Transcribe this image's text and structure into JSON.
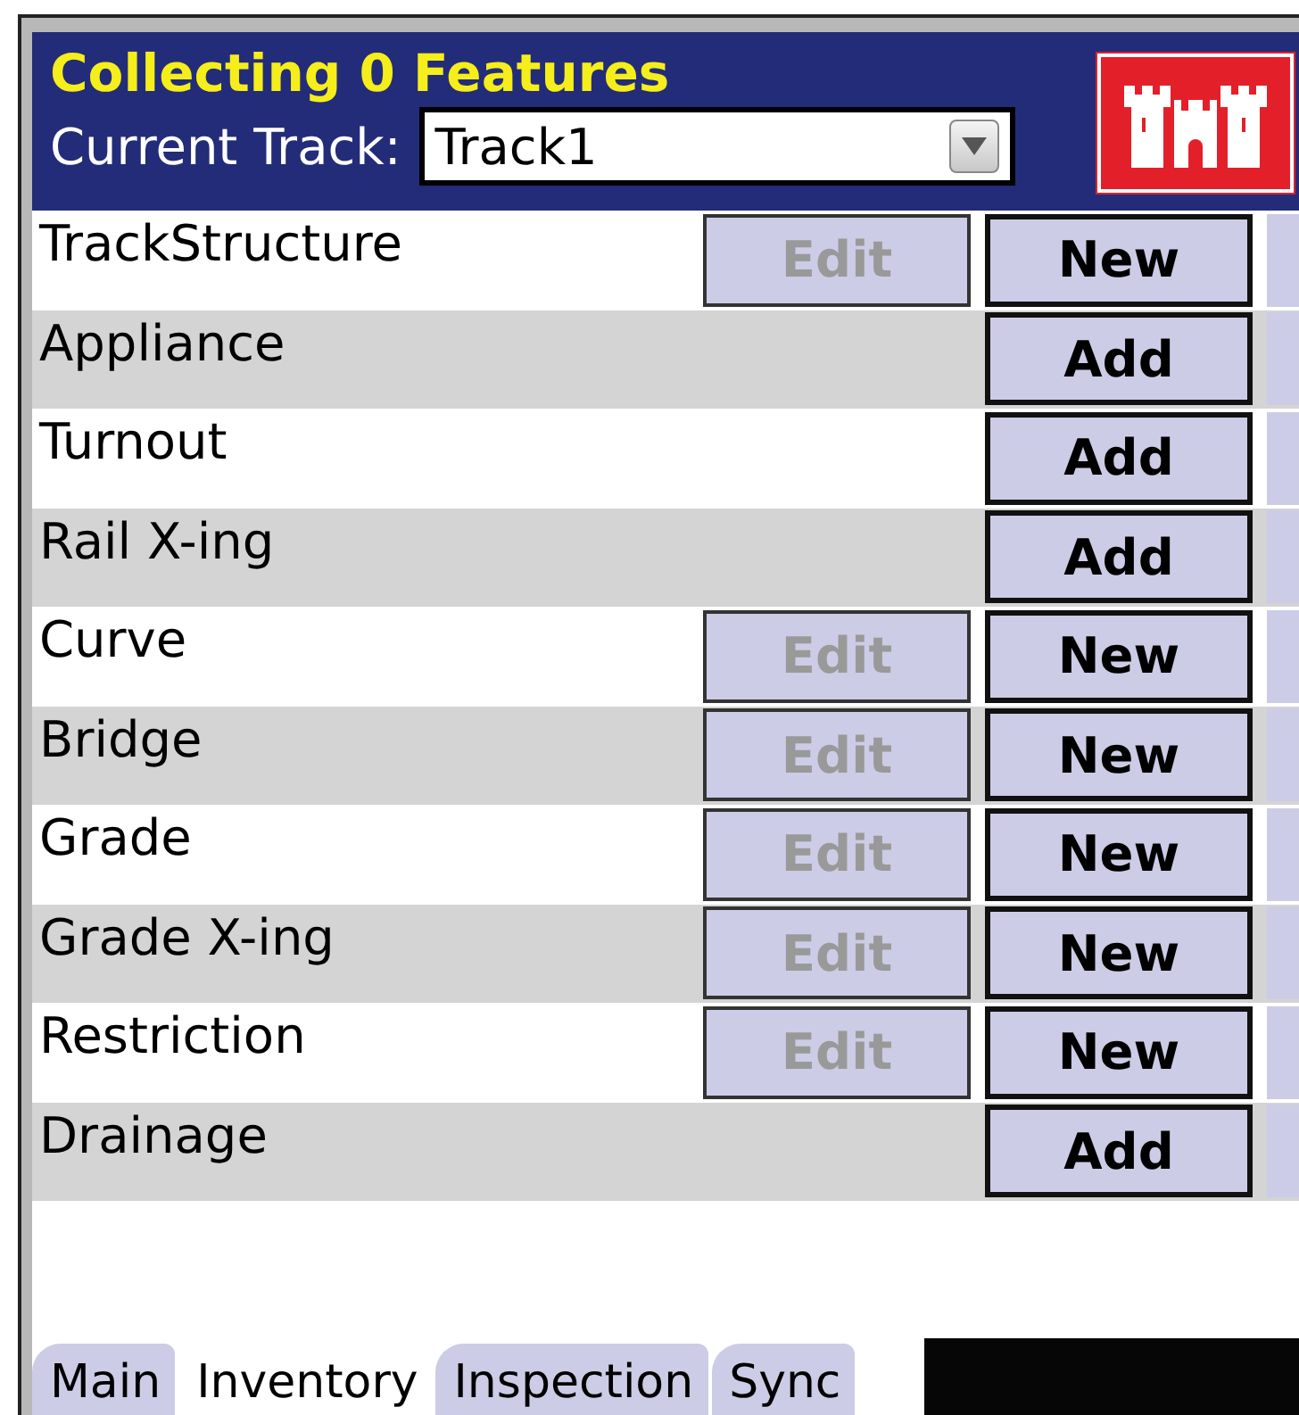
{
  "header": {
    "title": "Collecting 0 Features",
    "track_label": "Current Track:",
    "track_value": "Track1"
  },
  "rows": [
    {
      "label": "TrackStructure",
      "buttons": [
        {
          "label": "Edit",
          "disabled": true
        },
        {
          "label": "New",
          "disabled": false
        }
      ]
    },
    {
      "label": "Appliance",
      "buttons": [
        {
          "label": "Add",
          "disabled": false
        }
      ]
    },
    {
      "label": "Turnout",
      "buttons": [
        {
          "label": "Add",
          "disabled": false
        }
      ]
    },
    {
      "label": "Rail X-ing",
      "buttons": [
        {
          "label": "Add",
          "disabled": false
        }
      ]
    },
    {
      "label": "Curve",
      "buttons": [
        {
          "label": "Edit",
          "disabled": true
        },
        {
          "label": "New",
          "disabled": false
        }
      ]
    },
    {
      "label": "Bridge",
      "buttons": [
        {
          "label": "Edit",
          "disabled": true
        },
        {
          "label": "New",
          "disabled": false
        }
      ]
    },
    {
      "label": "Grade",
      "buttons": [
        {
          "label": "Edit",
          "disabled": true
        },
        {
          "label": "New",
          "disabled": false
        }
      ]
    },
    {
      "label": "Grade X-ing",
      "buttons": [
        {
          "label": "Edit",
          "disabled": true
        },
        {
          "label": "New",
          "disabled": false
        }
      ]
    },
    {
      "label": "Restriction",
      "buttons": [
        {
          "label": "Edit",
          "disabled": true
        },
        {
          "label": "New",
          "disabled": false
        }
      ]
    },
    {
      "label": "Drainage",
      "buttons": [
        {
          "label": "Add",
          "disabled": false
        }
      ]
    }
  ],
  "tabs": [
    {
      "label": "Main",
      "selected": false
    },
    {
      "label": "Inventory",
      "selected": true
    },
    {
      "label": "Inspection",
      "selected": false
    },
    {
      "label": "Sync",
      "selected": false
    }
  ]
}
